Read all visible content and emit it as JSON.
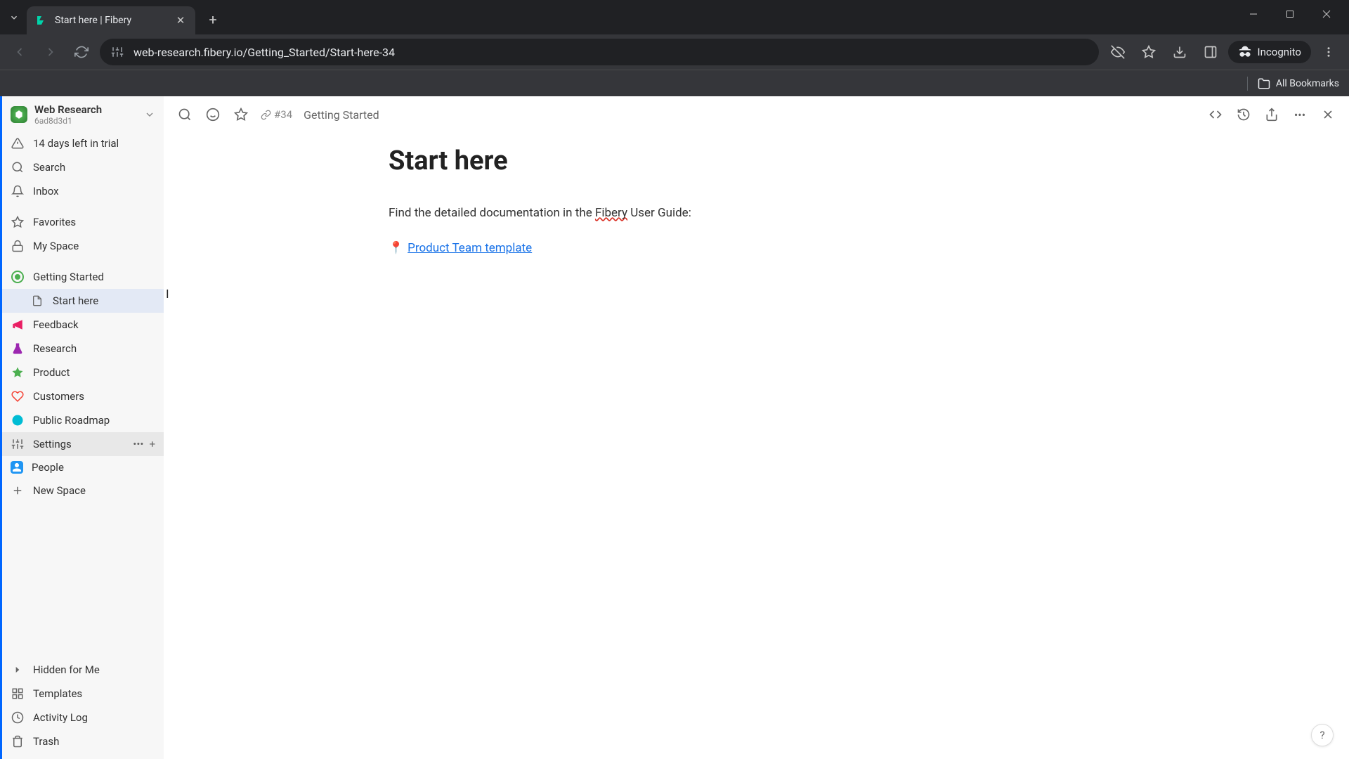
{
  "browser": {
    "tab_title": "Start here | Fibery",
    "url": "web-research.fibery.io/Getting_Started/Start-here-34",
    "incognito_label": "Incognito",
    "all_bookmarks_label": "All Bookmarks"
  },
  "workspace": {
    "name": "Web Research",
    "id": "6ad8d3d1"
  },
  "sidebar": {
    "trial": "14 days left in trial",
    "search": "Search",
    "inbox": "Inbox",
    "favorites": "Favorites",
    "my_space": "My Space",
    "spaces": {
      "getting_started": "Getting Started",
      "start_here": "Start here",
      "feedback": "Feedback",
      "research": "Research",
      "product": "Product",
      "customers": "Customers",
      "public_roadmap": "Public Roadmap",
      "settings": "Settings",
      "people": "People",
      "new_space": "New Space"
    },
    "bottom": {
      "hidden": "Hidden for Me",
      "templates": "Templates",
      "activity_log": "Activity Log",
      "trash": "Trash"
    }
  },
  "header": {
    "entity_id": "#34",
    "breadcrumb": "Getting Started"
  },
  "page": {
    "title": "Start here",
    "intro_before": "Find the detailed documentation in the ",
    "intro_underlined": "Fibery",
    "intro_after": " User Guide:",
    "link_emoji": "📍",
    "link_text": "Product Team template"
  },
  "help": "?"
}
